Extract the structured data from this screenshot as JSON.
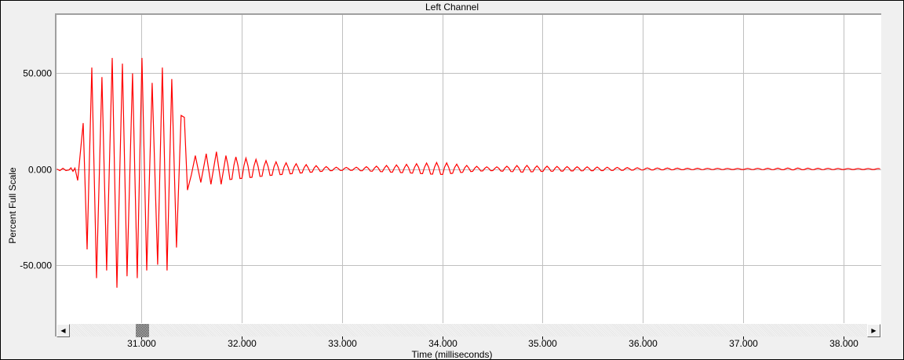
{
  "chart_data": {
    "type": "line",
    "title": "Left Channel",
    "xlabel": "Time (milliseconds)",
    "ylabel": "Percent Full Scale",
    "xlim": [
      30.156,
      38.375
    ],
    "ylim": [
      -80.5,
      80.5
    ],
    "grid": true,
    "x_ticks": [
      31,
      32,
      33,
      34,
      35,
      36,
      37,
      38
    ],
    "x_tick_labels": [
      "31.000",
      "32.000",
      "33.000",
      "34.000",
      "35.000",
      "36.000",
      "37.000",
      "38.000"
    ],
    "y_ticks": [
      50,
      0,
      -50
    ],
    "y_tick_labels": [
      "50.000",
      "0.000",
      "-50.000"
    ],
    "series": [
      {
        "name": "Left Channel",
        "color": "#ff0000",
        "points": [
          [
            30.16,
            0
          ],
          [
            30.19,
            -0.8
          ],
          [
            30.22,
            0.4
          ],
          [
            30.25,
            -0.8
          ],
          [
            30.28,
            -0.5
          ],
          [
            30.3,
            0.6
          ],
          [
            30.32,
            -1.2
          ],
          [
            30.34,
            0.5
          ],
          [
            30.367,
            -6
          ],
          [
            30.422,
            24
          ],
          [
            30.461,
            -42
          ],
          [
            30.508,
            53
          ],
          [
            30.555,
            -57
          ],
          [
            30.609,
            48
          ],
          [
            30.656,
            -53
          ],
          [
            30.711,
            58
          ],
          [
            30.758,
            -62
          ],
          [
            30.813,
            55
          ],
          [
            30.859,
            -56
          ],
          [
            30.914,
            50
          ],
          [
            30.961,
            -57
          ],
          [
            31.008,
            58
          ],
          [
            31.055,
            -53
          ],
          [
            31.109,
            45
          ],
          [
            31.164,
            -50
          ],
          [
            31.211,
            53
          ],
          [
            31.258,
            -53
          ],
          [
            31.305,
            47
          ],
          [
            31.352,
            -41
          ],
          [
            31.398,
            28
          ],
          [
            31.43,
            27
          ],
          [
            31.461,
            -11
          ],
          [
            31.5,
            -3
          ],
          [
            31.539,
            7
          ],
          [
            31.594,
            -7
          ],
          [
            31.648,
            8
          ],
          [
            31.695,
            -8
          ],
          [
            31.75,
            9
          ],
          [
            31.797,
            -8
          ],
          [
            31.844,
            7
          ]
        ],
        "tail_frequency_khz": 10,
        "tail_envelope": [
          [
            31.844,
            7
          ],
          [
            32.0,
            6
          ],
          [
            32.3,
            4
          ],
          [
            32.6,
            2.5
          ],
          [
            32.9,
            1
          ],
          [
            33.1,
            0.8
          ],
          [
            33.5,
            2
          ],
          [
            33.9,
            3.3
          ],
          [
            34.0,
            3.5
          ],
          [
            34.3,
            1.5
          ],
          [
            34.5,
            1
          ],
          [
            34.8,
            2
          ],
          [
            35.0,
            1.5
          ],
          [
            35.3,
            1.2
          ],
          [
            35.6,
            1
          ],
          [
            36.0,
            0.6
          ],
          [
            36.5,
            0.4
          ],
          [
            37.0,
            0.3
          ],
          [
            37.5,
            0.5
          ],
          [
            38.0,
            0.3
          ],
          [
            38.375,
            0.3
          ]
        ]
      }
    ]
  },
  "scrollbar": {
    "left_arrow": "◀",
    "right_arrow": "▶"
  }
}
